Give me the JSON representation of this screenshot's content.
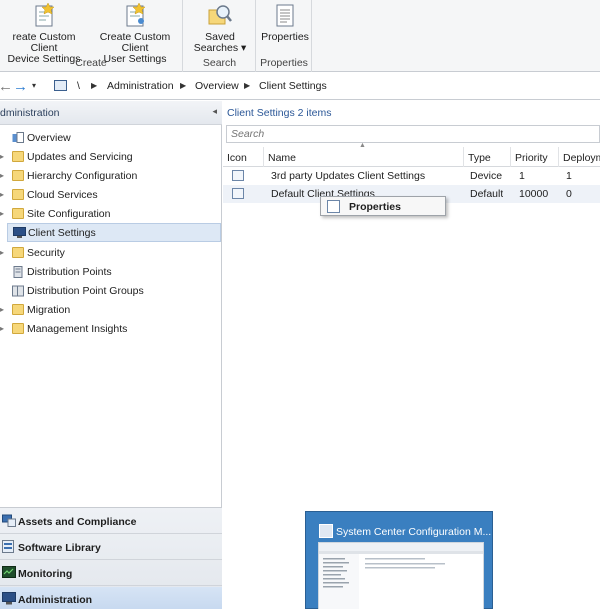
{
  "ribbon": {
    "groups": [
      {
        "label": "Create",
        "buttons": [
          {
            "line1": "reate Custom Client",
            "line2": "Device Settings"
          },
          {
            "line1": "Create Custom Client",
            "line2": "User Settings"
          }
        ]
      },
      {
        "label": "Search",
        "buttons": [
          {
            "line1": "Saved",
            "line2": "Searches ▾"
          }
        ]
      },
      {
        "label": "Properties",
        "buttons": [
          {
            "line1": "Properties",
            "line2": ""
          }
        ]
      }
    ]
  },
  "address": {
    "back": "←",
    "forward": "→",
    "root": "\\",
    "crumbs": [
      "Administration",
      "Overview",
      "Client Settings"
    ]
  },
  "leftpane": {
    "title": "dministration",
    "collapse": "◂",
    "tree": [
      {
        "label": "Overview",
        "icon": "overview-icon",
        "expand": ""
      },
      {
        "label": "Updates and Servicing",
        "icon": "folder-icon",
        "expand": "▸"
      },
      {
        "label": "Hierarchy Configuration",
        "icon": "folder-icon",
        "expand": "▸"
      },
      {
        "label": "Cloud Services",
        "icon": "folder-icon",
        "expand": "▸"
      },
      {
        "label": "Site Configuration",
        "icon": "folder-icon",
        "expand": "▸"
      },
      {
        "label": "Client Settings",
        "icon": "client-settings-icon",
        "expand": ""
      },
      {
        "label": "Security",
        "icon": "folder-icon",
        "expand": "▸"
      },
      {
        "label": "Distribution Points",
        "icon": "distribution-point-icon",
        "expand": ""
      },
      {
        "label": "Distribution Point Groups",
        "icon": "distribution-point-group-icon",
        "expand": ""
      },
      {
        "label": "Migration",
        "icon": "folder-icon",
        "expand": "▸"
      },
      {
        "label": "Management Insights",
        "icon": "folder-icon",
        "expand": "▸"
      }
    ],
    "workspaces": [
      {
        "label": "Assets and Compliance",
        "icon": "assets-icon"
      },
      {
        "label": "Software Library",
        "icon": "library-icon"
      },
      {
        "label": "Monitoring",
        "icon": "monitoring-icon"
      },
      {
        "label": "Administration",
        "icon": "administration-icon"
      }
    ]
  },
  "main": {
    "title": "Client Settings 2 items",
    "search_placeholder": "Search",
    "columns": [
      "Icon",
      "Name",
      "Type",
      "Priority",
      "Deployme"
    ],
    "rows": [
      {
        "name": "3rd party Updates Client Settings",
        "type": "Device",
        "priority": "1",
        "deployments": "1"
      },
      {
        "name": "Default Client Settings",
        "type": "Default",
        "priority": "10000",
        "deployments": "0"
      }
    ]
  },
  "context_menu": {
    "items": [
      {
        "label": "Properties"
      }
    ]
  },
  "taskbar_thumb": {
    "title": "System Center Configuration M..."
  },
  "colors": {
    "accent": "#2b5797",
    "selection": "#dde8f5",
    "folder": "#f6d77a",
    "taskbar": "#3a7fc0"
  }
}
